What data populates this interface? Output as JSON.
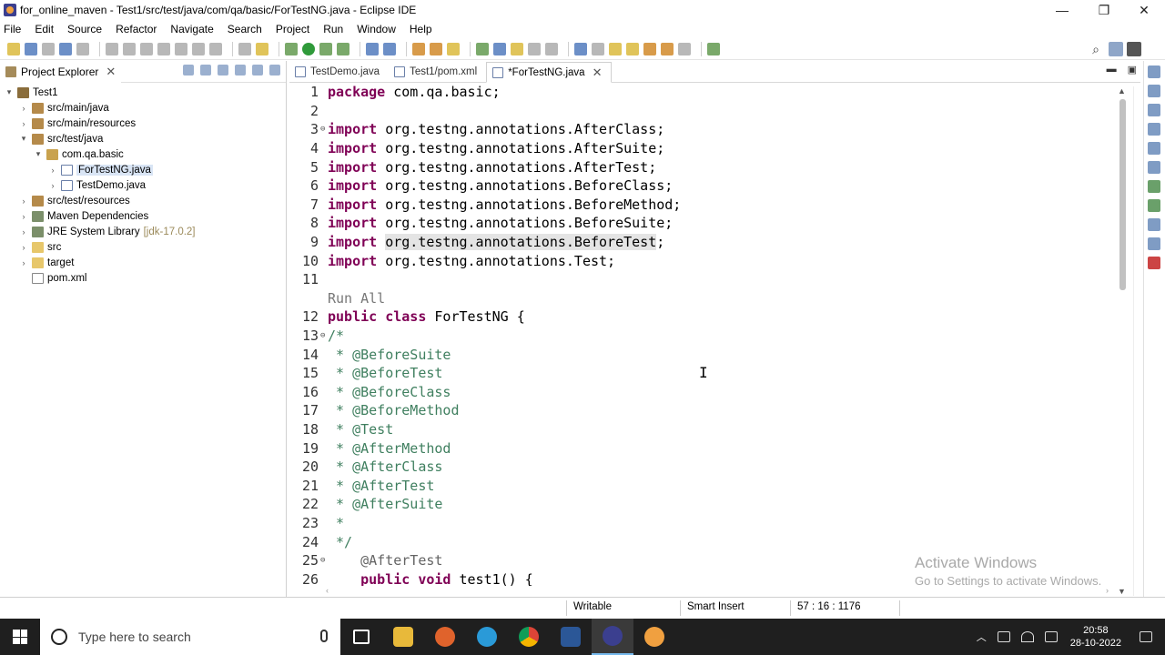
{
  "window": {
    "title": "for_online_maven - Test1/src/test/java/com/qa/basic/ForTestNG.java - Eclipse IDE",
    "controls": [
      "—",
      "❐",
      "✕"
    ]
  },
  "menu": [
    "File",
    "Edit",
    "Source",
    "Refactor",
    "Navigate",
    "Search",
    "Project",
    "Run",
    "Window",
    "Help"
  ],
  "explorer": {
    "title": "Project Explorer",
    "tree": [
      {
        "label": "Test1",
        "decoration": ""
      },
      {
        "label": "src/main/java",
        "decoration": ""
      },
      {
        "label": "src/main/resources",
        "decoration": ""
      },
      {
        "label": "src/test/java",
        "decoration": ""
      },
      {
        "label": "com.qa.basic",
        "decoration": ""
      },
      {
        "label": "ForTestNG.java",
        "decoration": ""
      },
      {
        "label": "TestDemo.java",
        "decoration": ""
      },
      {
        "label": "src/test/resources",
        "decoration": ""
      },
      {
        "label": "Maven Dependencies",
        "decoration": ""
      },
      {
        "label": "JRE System Library",
        "decoration": "[jdk-17.0.2]"
      },
      {
        "label": "src",
        "decoration": ""
      },
      {
        "label": "target",
        "decoration": ""
      },
      {
        "label": "pom.xml",
        "decoration": ""
      }
    ]
  },
  "editor": {
    "tabs": [
      "TestDemo.java",
      "Test1/pom.xml",
      "*ForTestNG.java"
    ],
    "code_mining": "Run All",
    "lines": [
      {
        "n": "1",
        "kw": "package",
        "rest": " com.qa.basic;"
      },
      {
        "n": "2",
        "kw": "",
        "rest": ""
      },
      {
        "n": "3",
        "kw": "import",
        "rest": " org.testng.annotations.AfterClass;"
      },
      {
        "n": "4",
        "kw": "import",
        "rest": " org.testng.annotations.AfterSuite;"
      },
      {
        "n": "5",
        "kw": "import",
        "rest": " org.testng.annotations.AfterTest;"
      },
      {
        "n": "6",
        "kw": "import",
        "rest": " org.testng.annotations.BeforeClass;"
      },
      {
        "n": "7",
        "kw": "import",
        "rest": " org.testng.annotations.BeforeMethod;"
      },
      {
        "n": "8",
        "kw": "import",
        "rest": " org.testng.annotations.BeforeSuite;"
      },
      {
        "n": "9",
        "kw": "import",
        "rest": "org.testng.annotations.BeforeTest"
      },
      {
        "n": "10",
        "kw": "import",
        "rest": " org.testng.annotations.Test;"
      },
      {
        "n": "11",
        "kw": "",
        "rest": ""
      },
      {
        "n": "12",
        "kw": "public class",
        "rest": " ForTestNG {"
      },
      {
        "n": "13",
        "kw": "",
        "rest": "/*"
      },
      {
        "n": "14",
        "kw": "",
        "rest": " * @BeforeSuite"
      },
      {
        "n": "15",
        "kw": "",
        "rest": " * @BeforeTest"
      },
      {
        "n": "16",
        "kw": "",
        "rest": " * @BeforeClass"
      },
      {
        "n": "17",
        "kw": "",
        "rest": " * @BeforeMethod"
      },
      {
        "n": "18",
        "kw": "",
        "rest": " * @Test"
      },
      {
        "n": "19",
        "kw": "",
        "rest": " * @AfterMethod"
      },
      {
        "n": "20",
        "kw": "",
        "rest": " * @AfterClass"
      },
      {
        "n": "21",
        "kw": "",
        "rest": " * @AfterTest"
      },
      {
        "n": "22",
        "kw": "",
        "rest": " * @AfterSuite"
      },
      {
        "n": "23",
        "kw": "",
        "rest": " *"
      },
      {
        "n": "24",
        "kw": "",
        "rest": " */"
      },
      {
        "n": "25",
        "kw": "",
        "rest": "    @AfterTest"
      },
      {
        "n": "26",
        "kw": "    public void",
        "rest": " test1() {"
      }
    ]
  },
  "status": {
    "writable": "Writable",
    "insert_mode": "Smart Insert",
    "position": "57 : 16 : 1176"
  },
  "watermark": {
    "line1": "Activate Windows",
    "line2": "Go to Settings to activate Windows."
  },
  "taskbar": {
    "search_placeholder": "Type here to search",
    "time": "20:58",
    "date": "28-10-2022"
  }
}
